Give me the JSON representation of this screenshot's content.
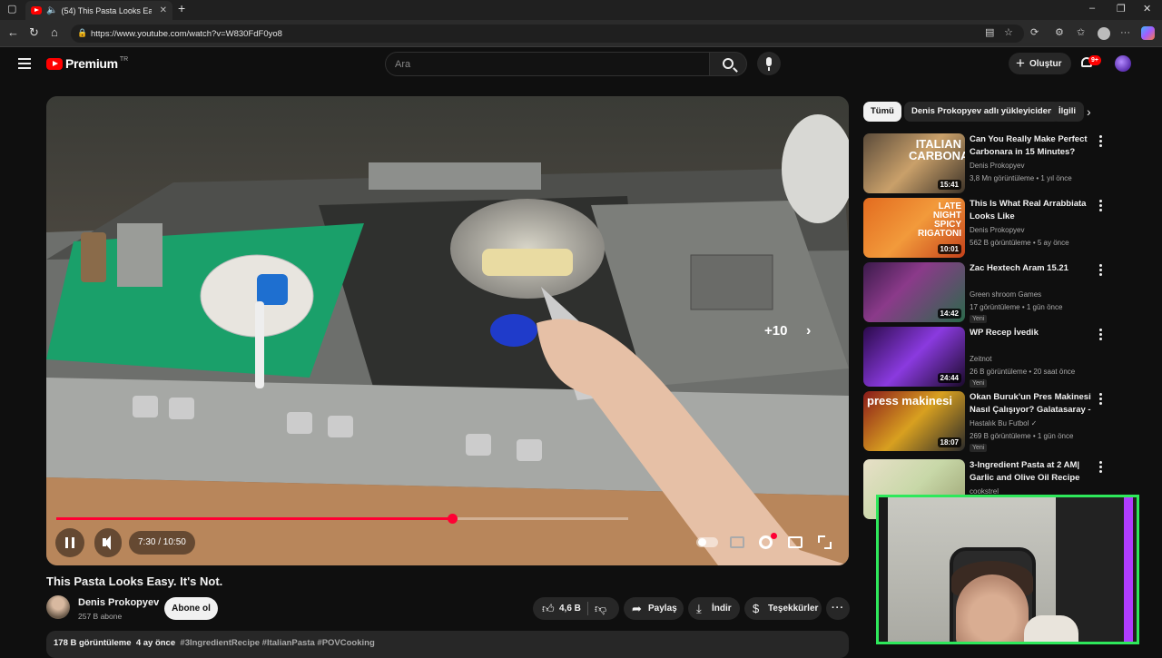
{
  "browser": {
    "tab_title": "(54) This Pasta Looks Easy. It'...",
    "url": "https://www.youtube.com/watch?v=W830FdF0yo8"
  },
  "header": {
    "logo_text": "Premium",
    "logo_region": "TR",
    "search_placeholder": "Ara",
    "create_label": "Oluştur",
    "notification_count": "9+"
  },
  "player": {
    "time": "7:30 / 10:50",
    "progress_fraction": 0.6923,
    "skip_label": "+10",
    "accent": "#ff0033"
  },
  "video": {
    "title": "This Pasta Looks Easy. It's Not.",
    "channel": "Denis Prokopyev",
    "subscribers": "257 B abone",
    "subscribe_label": "Abone ol",
    "likes": "4,6 B",
    "share_label": "Paylaş",
    "download_label": "İndir",
    "thanks_label": "Teşekkürler",
    "views": "178 B görüntüleme",
    "age": "4 ay önce",
    "tags": "#3IngredientRecipe #ItalianPasta #POVCooking"
  },
  "chips": [
    "Tümü",
    "Denis Prokopyev adlı yükleyiciden",
    "İlgili"
  ],
  "related": [
    {
      "title": "Can You Really Make Perfect Carbonara in 15 Minutes?",
      "channel": "Denis Prokopyev",
      "meta": "3,8 Mn görüntüleme • 1 yıl önce",
      "duration": "15:41",
      "thumb_text": "ITALIAN CARBONARA",
      "new": ""
    },
    {
      "title": "This Is What Real Arrabbiata Looks Like",
      "channel": "Denis Prokopyev",
      "meta": "562 B görüntüleme • 5 ay önce",
      "duration": "10:01",
      "thumb_text": "LATE NIGHT SPICY RIGATONI",
      "new": ""
    },
    {
      "title": "Zac Hextech Aram 15.21",
      "channel": "Green shroom Games",
      "meta": "17 görüntüleme • 1 gün önce",
      "duration": "14:42",
      "thumb_text": "",
      "new": "Yeni"
    },
    {
      "title": "WP Recep İvedik",
      "channel": "Zeitnot",
      "meta": "26 B görüntüleme • 20 saat önce",
      "duration": "24:44",
      "thumb_text": "",
      "new": "Yeni"
    },
    {
      "title": "Okan Buruk'un Pres Makinesi Nasıl Çalışıyor? Galatasaray - ...",
      "channel": "Hastalık Bu Futbol ✓",
      "meta": "269 B görüntüleme • 1 gün önce",
      "duration": "18:07",
      "thumb_text": "press makinesi",
      "new": "Yeni"
    },
    {
      "title": "3-Ingredient Pasta at 2 AM| Garlic and Olive Oil Recipe",
      "channel": "cookstrel",
      "meta": "",
      "duration": "",
      "thumb_text": "",
      "new": ""
    }
  ]
}
